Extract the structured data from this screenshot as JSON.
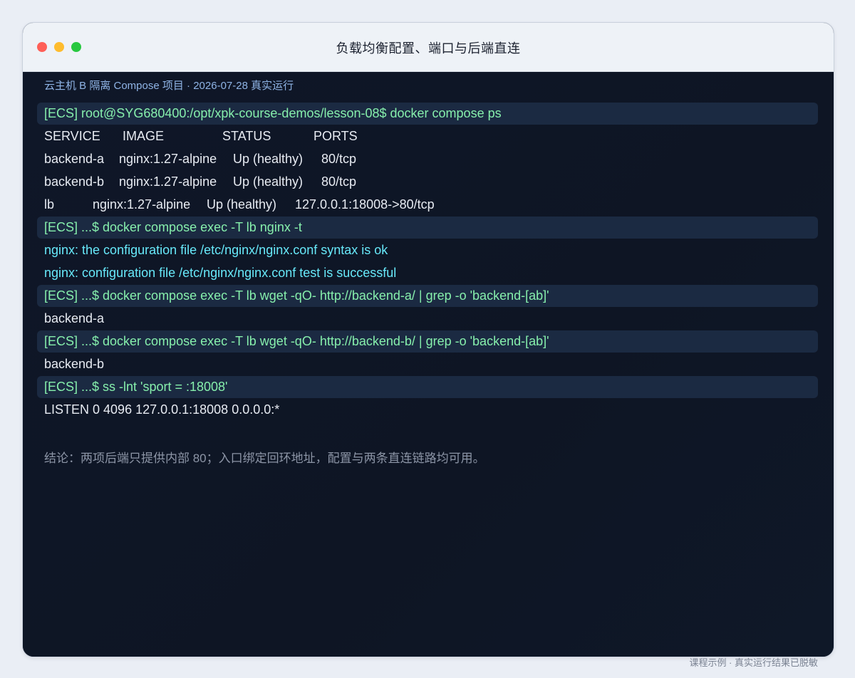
{
  "window": {
    "title": "负载均衡配置、端口与后端直连"
  },
  "terminal": {
    "subheader": "云主机 B 隔离 Compose 项目 · 2026-07-28 真实运行",
    "cmd1": "[ECS] root@SYG680400:/opt/xpk-course-demos/lesson-08$ docker compose ps",
    "table": {
      "headers": [
        "SERVICE",
        "IMAGE",
        "STATUS",
        "PORTS"
      ],
      "rows": [
        [
          "backend-a",
          "nginx:1.27-alpine",
          "Up (healthy)",
          "80/tcp"
        ],
        [
          "backend-b",
          "nginx:1.27-alpine",
          "Up (healthy)",
          "80/tcp"
        ],
        [
          "lb",
          "nginx:1.27-alpine",
          "Up (healthy)",
          "127.0.0.1:18008->80/tcp"
        ]
      ]
    },
    "cmd2": "[ECS] ...$ docker compose exec -T lb nginx -t",
    "nginx_out1": "nginx: the configuration file /etc/nginx/nginx.conf syntax is ok",
    "nginx_out2": "nginx: configuration file /etc/nginx/nginx.conf test is successful",
    "cmd3": "[ECS] ...$ docker compose exec -T lb wget -qO- http://backend-a/ | grep -o 'backend-[ab]'",
    "out3": "backend-a",
    "cmd4": "[ECS] ...$ docker compose exec -T lb wget -qO- http://backend-b/ | grep -o 'backend-[ab]'",
    "out4": "backend-b",
    "cmd5": "[ECS] ...$ ss -lnt 'sport = :18008'",
    "out5": "LISTEN 0 4096 127.0.0.1:18008 0.0.0.0:*",
    "conclusion": "结论：两项后端只提供内部 80；入口绑定回环地址，配置与两条直连链路均可用。"
  },
  "footer": {
    "note": "课程示例 · 真实运行结果已脱敏"
  },
  "colors": {
    "command": "#86efac",
    "nginx_output": "#67e8f9",
    "output": "#e7ebf2",
    "subheader": "#8fb4e6"
  }
}
